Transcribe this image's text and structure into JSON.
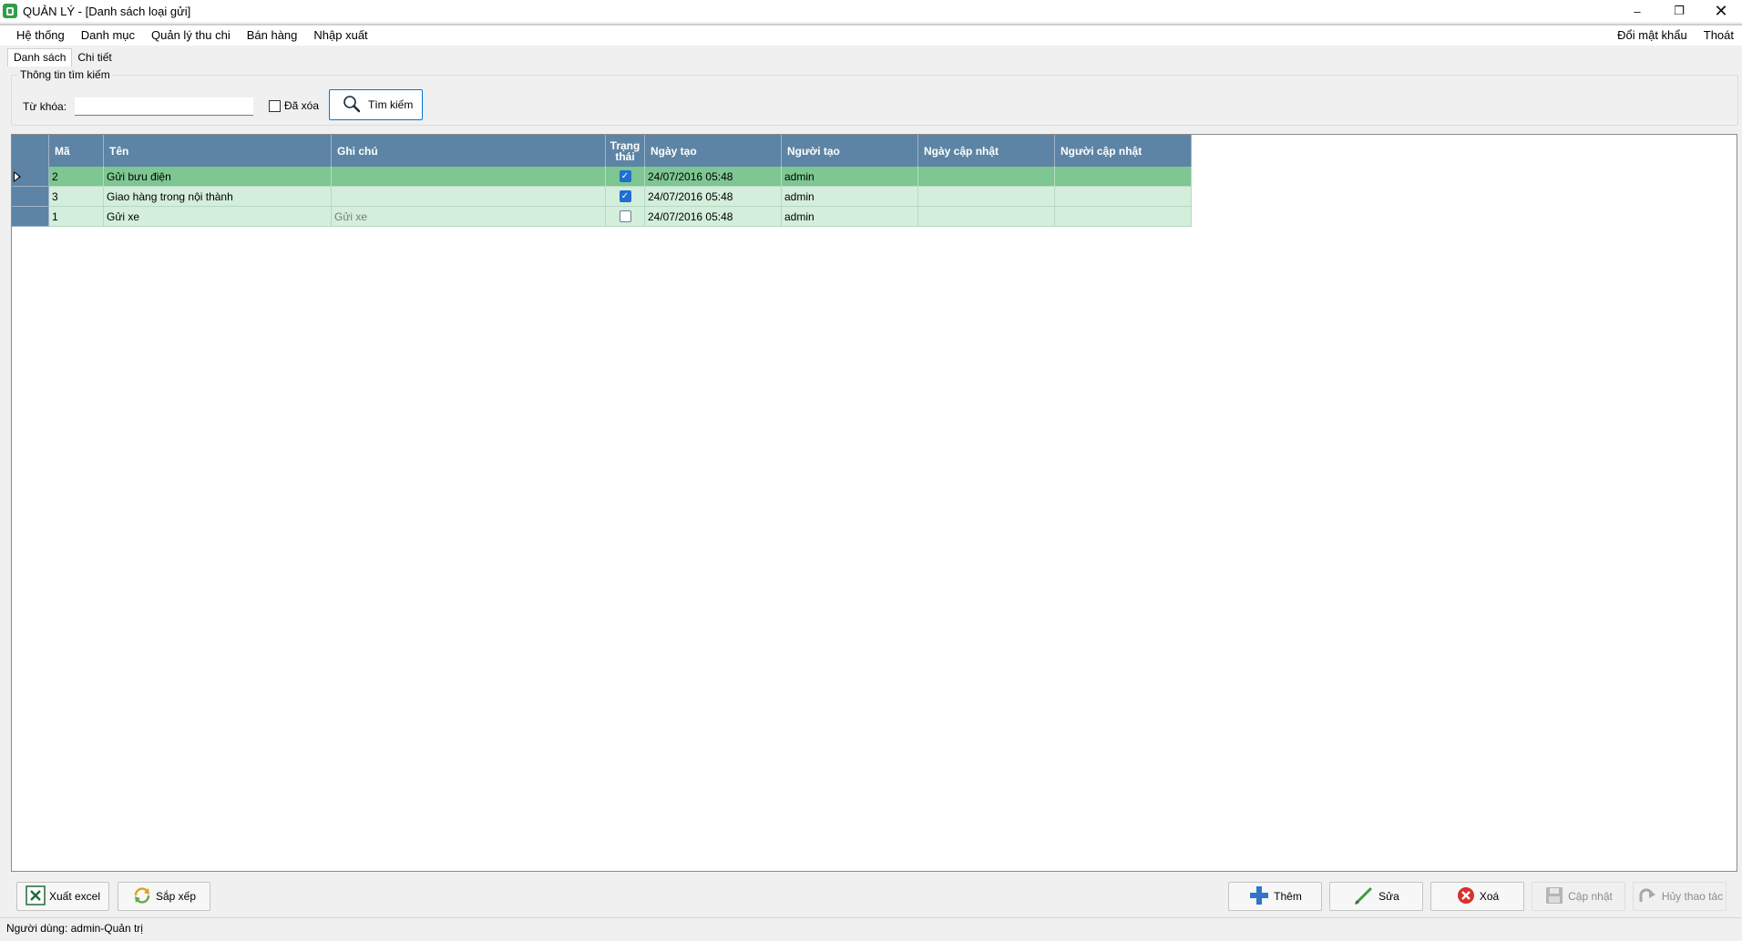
{
  "window": {
    "title": "QUẢN LÝ - [Danh sách loại gửi]",
    "minimize": "–",
    "restore": "❐",
    "close": "✕"
  },
  "menu": {
    "items": [
      "Hệ thống",
      "Danh mục",
      "Quản lý thu chi",
      "Bán hàng",
      "Nhập xuất"
    ],
    "right": [
      "Đổi mật khẩu",
      "Thoát"
    ]
  },
  "tabs": [
    "Danh sách",
    "Chi tiết"
  ],
  "search": {
    "legend": "Thông tin tìm kiếm",
    "keyword_label": "Từ khóa:",
    "keyword_value": "",
    "deleted_label": "Đã xóa",
    "deleted_checked": false,
    "button_label": "Tìm kiếm"
  },
  "grid": {
    "headers": [
      "Mã",
      "Tên",
      "Ghi chú",
      "Trạng thái",
      "Ngày tạo",
      "Người tạo",
      "Ngày cập nhật",
      "Người cập nhật"
    ],
    "rows": [
      {
        "ma": "2",
        "ten": "Gửi bưu điện",
        "ghi_chu": "",
        "trang_thai": true,
        "ngay_tao": "24/07/2016 05:48",
        "nguoi_tao": "admin",
        "ngay_cap_nhat": "",
        "nguoi_cap_nhat": "",
        "selected": true
      },
      {
        "ma": "3",
        "ten": "Giao hàng trong nội thành",
        "ghi_chu": "",
        "trang_thai": true,
        "ngay_tao": "24/07/2016 05:48",
        "nguoi_tao": "admin",
        "ngay_cap_nhat": "",
        "nguoi_cap_nhat": "",
        "selected": false
      },
      {
        "ma": "1",
        "ten": "Gửi xe",
        "ghi_chu": "Gửi xe",
        "trang_thai": false,
        "ngay_tao": "24/07/2016 05:48",
        "nguoi_tao": "admin",
        "ngay_cap_nhat": "",
        "nguoi_cap_nhat": "",
        "selected": false
      }
    ]
  },
  "toolbar": {
    "export_excel": "Xuất excel",
    "sort": "Sắp xếp",
    "add": "Thêm",
    "edit": "Sửa",
    "delete": "Xoá",
    "update": "Cập nhật",
    "cancel": "Hủy thao tác"
  },
  "status": {
    "user": "Người dùng: admin-Quản trị"
  },
  "colors": {
    "header": "#5d84a4",
    "selected_row": "#7ec692",
    "row": "#d3eedb",
    "search_button_border": "#0078d7"
  }
}
